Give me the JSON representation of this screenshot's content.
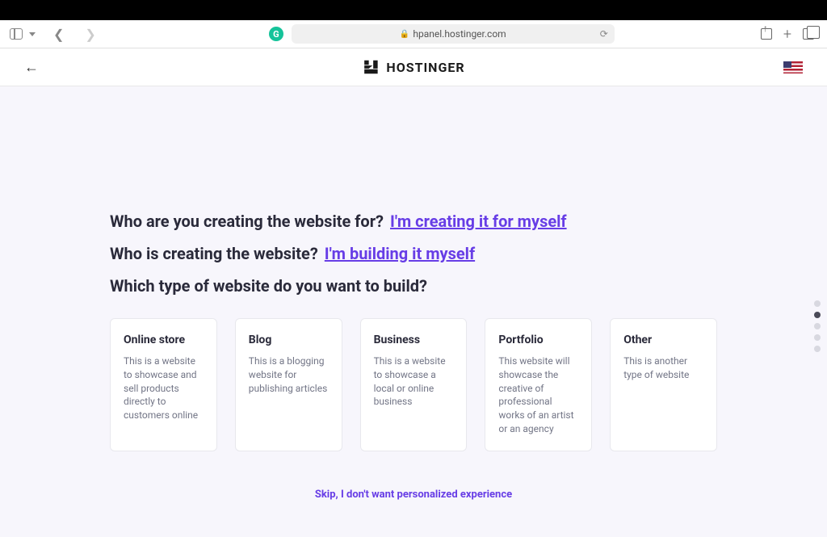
{
  "browser": {
    "url": "hpanel.hostinger.com"
  },
  "header": {
    "brand": "HOSTINGER"
  },
  "questions": {
    "q1": {
      "label": "Who are you creating the website for?",
      "answer": "I'm creating it for myself"
    },
    "q2": {
      "label": "Who is creating the website?",
      "answer": "I'm building it myself"
    },
    "q3": {
      "label": "Which type of website do you want to build?"
    }
  },
  "cards": [
    {
      "title": "Online store",
      "desc": "This is a website to showcase and sell products directly to customers online"
    },
    {
      "title": "Blog",
      "desc": "This is a blogging website for publishing articles"
    },
    {
      "title": "Business",
      "desc": "This is a website to showcase a local or online business"
    },
    {
      "title": "Portfolio",
      "desc": "This website will showcase the creative of professional works of an artist or an agency"
    },
    {
      "title": "Other",
      "desc": "This is another type of website"
    }
  ],
  "footer": {
    "skip": "Skip, I don't want personalized experience"
  }
}
